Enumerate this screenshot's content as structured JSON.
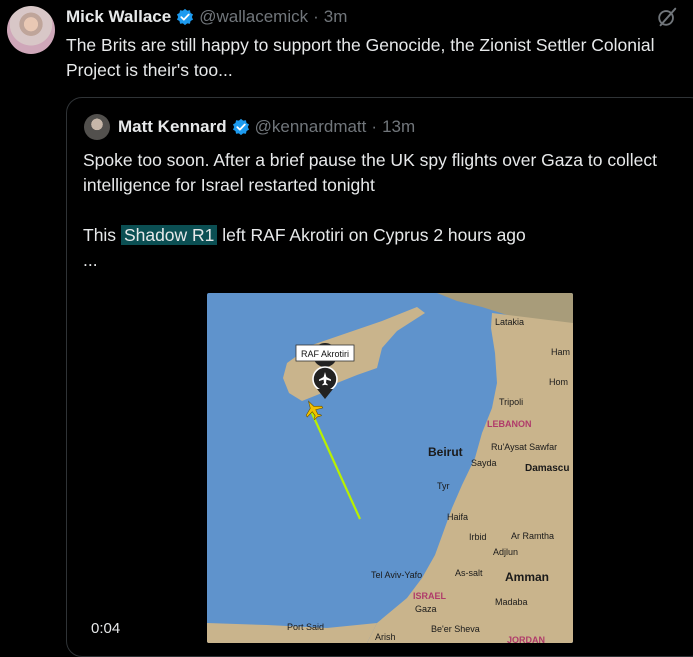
{
  "tweet": {
    "author_name": "Mick Wallace",
    "author_handle": "@wallacemick",
    "separator": "·",
    "time": "3m",
    "text": "The Brits are still happy to support the Genocide, the Zionist Settler Colonial Project is their's too..."
  },
  "quote": {
    "author_name": "Matt Kennard",
    "author_handle": "@kennardmatt",
    "separator": "·",
    "time": "13m",
    "line1": "Spoke too soon. After a brief pause the UK spy flights over Gaza to collect intelligence for Israel restarted tonight",
    "line2_prefix": "This",
    "line2_highlight": "Shadow R1",
    "line2_suffix": "left RAF Akrotiri on Cyprus 2 hours ago",
    "ellipsis": "..."
  },
  "video": {
    "duration": "0:04"
  },
  "map": {
    "callout": "RAF Akrotiri",
    "places": {
      "latakia": "Latakia",
      "ham": "Ham",
      "hom": "Hom",
      "tripoli": "Tripoli",
      "lebanon": "LEBANON",
      "beirut": "Beirut",
      "ruaysat": "Ru'Aysat Sawfar",
      "sayda": "Sayda",
      "damascus": "Damascu",
      "tyr": "Tyr",
      "haifa": "Haifa",
      "irbid": "Irbid",
      "arramtha": "Ar Ramtha",
      "adjlun": "Adjlun",
      "telaviv": "Tel Aviv-Yafo",
      "assalt": "As-salt",
      "amman": "Amman",
      "israel": "ISRAEL",
      "gaza": "Gaza",
      "madaba": "Madaba",
      "portsaid": "Port Said",
      "arish": "Arish",
      "beersheva": "Be'er Sheva",
      "jordan": "JORDAN"
    },
    "colors": {
      "sea": "#5f93cc",
      "land": "#c9b48c",
      "land_north": "#a89c7a",
      "track": "#b8f000",
      "aircraft": "#f2c200"
    }
  }
}
